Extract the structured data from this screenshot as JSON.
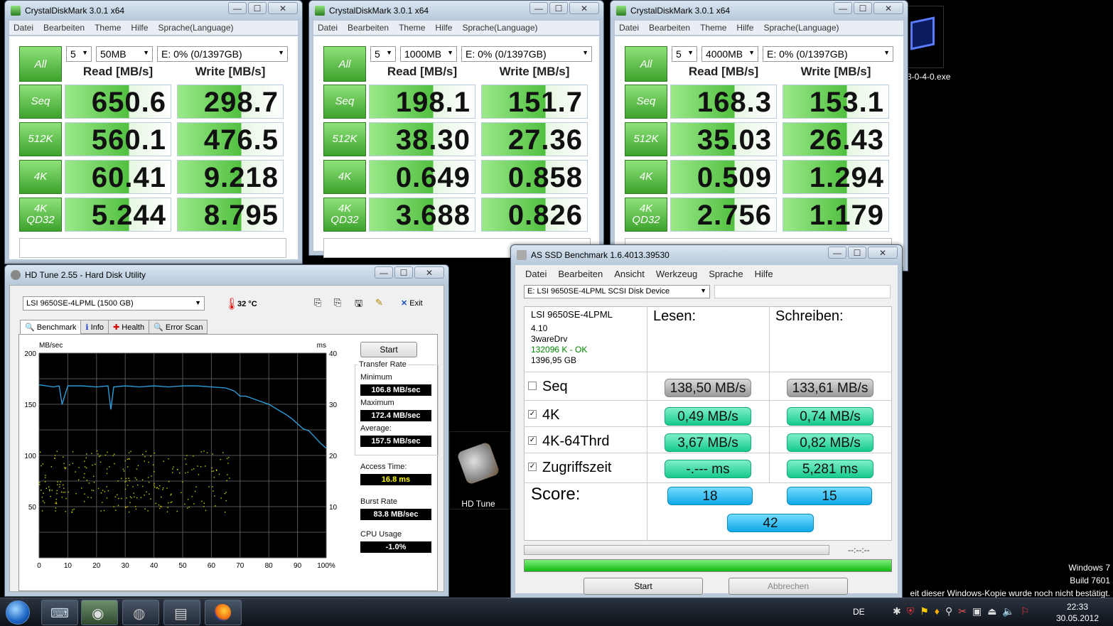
{
  "desktop": {
    "icon_label": "3-0-4-0.exe",
    "hdtune_label": "HD Tune",
    "watermark": [
      "Windows 7",
      "Build 7601",
      "eit dieser Windows-Kopie wurde noch nicht bestätigt."
    ]
  },
  "cdm": [
    {
      "title": "CrystalDiskMark 3.0.1 x64",
      "menu": [
        "Datei",
        "Bearbeiten",
        "Theme",
        "Hilfe",
        "Sprache(Language)"
      ],
      "all_label": "All",
      "count": "5",
      "size": "50MB",
      "drive": "E: 0% (0/1397GB)",
      "read_header": "Read [MB/s]",
      "write_header": "Write [MB/s]",
      "rows": [
        {
          "label": "Seq",
          "read": "650.6",
          "write": "298.7"
        },
        {
          "label": "512K",
          "read": "560.1",
          "write": "476.5"
        },
        {
          "label": "4K",
          "read": "60.41",
          "write": "9.218"
        },
        {
          "label": "4K QD32",
          "read": "5.244",
          "write": "8.795"
        }
      ]
    },
    {
      "title": "CrystalDiskMark 3.0.1 x64",
      "menu": [
        "Datei",
        "Bearbeiten",
        "Theme",
        "Hilfe",
        "Sprache(Language)"
      ],
      "all_label": "All",
      "count": "5",
      "size": "1000MB",
      "drive": "E: 0% (0/1397GB)",
      "read_header": "Read [MB/s]",
      "write_header": "Write [MB/s]",
      "rows": [
        {
          "label": "Seq",
          "read": "198.1",
          "write": "151.7"
        },
        {
          "label": "512K",
          "read": "38.30",
          "write": "27.36"
        },
        {
          "label": "4K",
          "read": "0.649",
          "write": "0.858"
        },
        {
          "label": "4K QD32",
          "read": "3.688",
          "write": "0.826"
        }
      ]
    },
    {
      "title": "CrystalDiskMark 3.0.1 x64",
      "menu": [
        "Datei",
        "Bearbeiten",
        "Theme",
        "Hilfe",
        "Sprache(Language)"
      ],
      "all_label": "All",
      "count": "5",
      "size": "4000MB",
      "drive": "E: 0% (0/1397GB)",
      "read_header": "Read [MB/s]",
      "write_header": "Write [MB/s]",
      "rows": [
        {
          "label": "Seq",
          "read": "168.3",
          "write": "153.1"
        },
        {
          "label": "512K",
          "read": "35.03",
          "write": "26.43"
        },
        {
          "label": "4K",
          "read": "0.509",
          "write": "1.294"
        },
        {
          "label": "4K QD32",
          "read": "2.756",
          "write": "1.179"
        }
      ]
    }
  ],
  "hdtune": {
    "title": "HD Tune 2.55 - Hard Disk Utility",
    "drive": "LSI    9650SE-4LPML (1500 GB)",
    "temp": "32 °C",
    "exit_label": "Exit",
    "tabs": [
      "Benchmark",
      "Info",
      "Health",
      "Error Scan"
    ],
    "start_label": "Start",
    "transfer_rate_label": "Transfer Rate",
    "minimum_label": "Minimum",
    "minimum": "106.8 MB/sec",
    "maximum_label": "Maximum",
    "maximum": "172.4 MB/sec",
    "average_label": "Average:",
    "average": "157.5 MB/sec",
    "access_time_label": "Access Time:",
    "access_time": "16.8 ms",
    "burst_rate_label": "Burst Rate",
    "burst_rate": "83.8 MB/sec",
    "cpu_usage_label": "CPU Usage",
    "cpu_usage": "-1.0%",
    "chart_data": {
      "type": "line",
      "ylabel_left": "MB/sec",
      "ylabel_right": "ms",
      "y_left_ticks": [
        "200",
        "150",
        "100",
        "50"
      ],
      "y_right_ticks": [
        "40",
        "30",
        "20",
        "10"
      ],
      "x_ticks": [
        "0",
        "10",
        "20",
        "30",
        "40",
        "50",
        "60",
        "70",
        "80",
        "90",
        "100%"
      ],
      "ylim": [
        0,
        200
      ],
      "y2lim": [
        0,
        40
      ],
      "grid": true,
      "series": [
        {
          "color": "#2ea6e8",
          "x": [
            0,
            5,
            7,
            8,
            10,
            15,
            20,
            24,
            25,
            26,
            30,
            35,
            40,
            45,
            50,
            55,
            60,
            65,
            68,
            70,
            72,
            75,
            78,
            80,
            83,
            86,
            88,
            90,
            92,
            94,
            96,
            98,
            100
          ],
          "y": [
            169,
            167,
            168,
            150,
            168,
            168,
            167,
            168,
            145,
            167,
            168,
            167,
            168,
            167,
            168,
            168,
            167,
            166,
            163,
            158,
            158,
            155,
            152,
            150,
            145,
            140,
            136,
            131,
            126,
            124,
            118,
            112,
            107
          ]
        }
      ],
      "access_points_y2_range": [
        9,
        21
      ],
      "access_points_color": "#d4d400"
    }
  },
  "asssd": {
    "title": "AS SSD Benchmark 1.6.4013.39530",
    "menu": [
      "Datei",
      "Bearbeiten",
      "Ansicht",
      "Werkzeug",
      "Sprache",
      "Hilfe"
    ],
    "drive_select": "E: LSI 9650SE-4LPML SCSI Disk Device",
    "info": {
      "name": "LSI 9650SE-4LPML",
      "fw": "4.10",
      "driver": "3wareDrv",
      "align": "132096 K - OK",
      "size": "1396,95 GB"
    },
    "read_header": "Lesen:",
    "write_header": "Schreiben:",
    "rows": [
      {
        "label": "Seq",
        "checked": false,
        "read": "138,50 MB/s",
        "write": "133,61 MB/s"
      },
      {
        "label": "4K",
        "checked": true,
        "read": "0,49 MB/s",
        "write": "0,74 MB/s"
      },
      {
        "label": "4K-64Thrd",
        "checked": true,
        "read": "3,67 MB/s",
        "write": "0,82 MB/s"
      },
      {
        "label": "Zugriffszeit",
        "checked": true,
        "read": "-.--- ms",
        "write": "5,281 ms"
      }
    ],
    "score_label": "Score:",
    "score_read": "18",
    "score_write": "15",
    "score_total": "42",
    "time_display": "--:--:--",
    "progress": 1.0,
    "start_label": "Start",
    "abort_label": "Abbrechen"
  },
  "taskbar": {
    "lang": "DE",
    "time": "22:33",
    "date": "30.05.2012"
  }
}
